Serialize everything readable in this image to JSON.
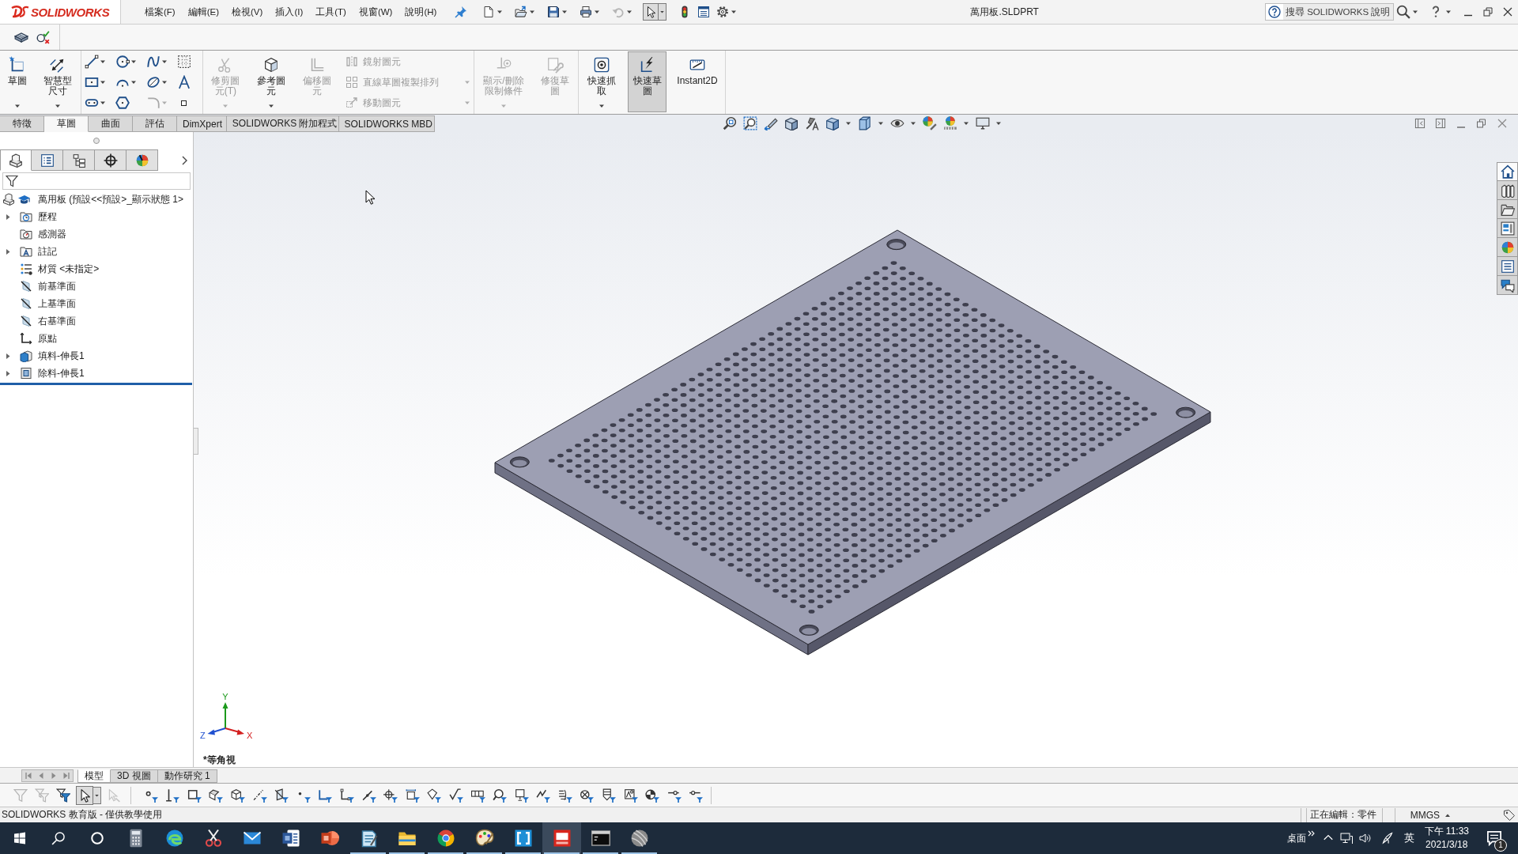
{
  "titlebar": {
    "logo": "SOLIDWORKS",
    "menus": [
      "檔案(F)",
      "編輯(E)",
      "檢視(V)",
      "插入(I)",
      "工具(T)",
      "視窗(W)",
      "說明(H)"
    ],
    "quick_access": [
      {
        "kind": "new",
        "dropdown": true,
        "disabled": false,
        "pressed": false
      },
      {
        "kind": "open",
        "dropdown": true,
        "disabled": false,
        "pressed": false
      },
      {
        "kind": "save",
        "dropdown": true,
        "disabled": false,
        "pressed": false
      },
      {
        "kind": "print",
        "dropdown": true,
        "disabled": false,
        "pressed": false
      },
      {
        "kind": "undo",
        "dropdown": true,
        "disabled": true,
        "pressed": false
      },
      {
        "kind": "select",
        "dropdown": true,
        "disabled": false,
        "pressed": true
      },
      {
        "kind": "rebuild",
        "dropdown": false,
        "disabled": false,
        "pressed": false
      },
      {
        "kind": "file-properties",
        "dropdown": false,
        "disabled": false,
        "pressed": false
      },
      {
        "kind": "options",
        "dropdown": true,
        "disabled": false,
        "pressed": false
      }
    ],
    "title": "萬用板.SLDPRT",
    "search": {
      "placeholder": "搜尋 SOLIDWORKS 說明"
    }
  },
  "ribbon": [
    {
      "items": [
        {
          "kind": "sketch",
          "label": "草圖",
          "dropdown": true,
          "disabled": false,
          "pressed": false
        },
        {
          "kind": "smart-dimension",
          "label": "智慧型尺寸",
          "dropdown": true,
          "disabled": false,
          "pressed": false
        }
      ]
    },
    {
      "items": [
        {
          "tools": [
            {
              "kind": "line",
              "dropdown": true,
              "disabled": false
            },
            {
              "kind": "circle",
              "dropdown": true,
              "disabled": false
            },
            {
              "kind": "spline",
              "dropdown": true,
              "disabled": false
            },
            {
              "kind": "grid-snap",
              "dropdown": false,
              "disabled": false
            },
            {
              "kind": "rectangle",
              "dropdown": true,
              "disabled": false
            },
            {
              "kind": "arc",
              "dropdown": true,
              "disabled": false
            },
            {
              "kind": "ellipse",
              "dropdown": true,
              "disabled": false
            },
            {
              "kind": "text",
              "dropdown": false,
              "disabled": false
            },
            {
              "kind": "slot",
              "dropdown": true,
              "disabled": false
            },
            {
              "kind": "polygon",
              "dropdown": false,
              "disabled": false
            },
            {
              "kind": "fillet",
              "dropdown": true,
              "disabled": true
            },
            {
              "kind": "point",
              "dropdown": false,
              "disabled": false
            }
          ]
        }
      ]
    },
    {
      "items": [
        {
          "kind": "trim-entities",
          "label": "修剪圖元(T)",
          "dropdown": true,
          "disabled": true,
          "pressed": false
        },
        {
          "kind": "convert-entities",
          "label": "參考圖元",
          "dropdown": true,
          "disabled": false,
          "pressed": false
        },
        {
          "kind": "offset-entities",
          "label": "偏移圖元",
          "dropdown": false,
          "disabled": true,
          "pressed": false
        },
        {
          "rows": [
            {
              "kind": "mirror-entities",
              "label": "鏡射圖元",
              "dropdown": false,
              "disabled": true
            },
            {
              "kind": "linear-pattern",
              "label": "直線草圖複製排列",
              "dropdown": true,
              "disabled": true
            },
            {
              "kind": "move-entities",
              "label": "移動圖元",
              "dropdown": true,
              "disabled": true
            }
          ]
        }
      ]
    },
    {
      "items": [
        {
          "kind": "display-relations",
          "label": "顯示/刪除限制條件",
          "dropdown": true,
          "disabled": true,
          "pressed": false
        },
        {
          "kind": "repair-sketch",
          "label": "修復草圖",
          "dropdown": false,
          "disabled": true,
          "pressed": false
        }
      ]
    },
    {
      "items": [
        {
          "kind": "quick-snaps",
          "label": "快速抓取",
          "dropdown": true,
          "disabled": false,
          "pressed": false
        },
        {
          "kind": "rapid-sketch",
          "label": "快速草圖",
          "dropdown": false,
          "disabled": false,
          "pressed": true
        },
        {
          "kind": "instant2d",
          "label": "Instant2D",
          "dropdown": false,
          "disabled": false,
          "pressed": false
        }
      ]
    }
  ],
  "command_tabs": [
    {
      "label": "特徵",
      "selected": false
    },
    {
      "label": "草圖",
      "selected": true
    },
    {
      "label": "曲面",
      "selected": false
    },
    {
      "label": "評估",
      "selected": false
    },
    {
      "label": "DimXpert",
      "selected": false
    },
    {
      "label": "SOLIDWORKS 附加程式",
      "selected": false
    },
    {
      "label": "SOLIDWORKS MBD",
      "selected": false
    }
  ],
  "view_toolbar": [
    {
      "kind": "zoom-fit",
      "dropdown": false
    },
    {
      "kind": "zoom-area",
      "dropdown": false
    },
    {
      "kind": "previous-view",
      "dropdown": false
    },
    {
      "kind": "section-view",
      "dropdown": false
    },
    {
      "kind": "annotation-views",
      "dropdown": false
    },
    {
      "kind": "view-orientation",
      "dropdown": true
    },
    {
      "kind": "display-style",
      "dropdown": true
    },
    {
      "kind": "hide-show",
      "dropdown": true
    },
    {
      "kind": "edit-appearance",
      "dropdown": false
    },
    {
      "kind": "apply-scene",
      "dropdown": true
    },
    {
      "kind": "view-settings",
      "dropdown": true
    }
  ],
  "feature_manager": {
    "tabs": [
      {
        "kind": "features",
        "selected": true
      },
      {
        "kind": "properties",
        "selected": false
      },
      {
        "kind": "configurations",
        "selected": false
      },
      {
        "kind": "dimxpert",
        "selected": false
      },
      {
        "kind": "display-manager",
        "selected": false
      }
    ],
    "tree": {
      "kind": "part",
      "label": "萬用板 (預設<<預設>_顯示狀態 1>",
      "children": [
        {
          "kind": "history",
          "label": "歷程",
          "expandable": true
        },
        {
          "kind": "sensors",
          "label": "感測器",
          "expandable": false
        },
        {
          "kind": "annotations",
          "label": "註記",
          "expandable": true
        },
        {
          "kind": "material",
          "label": "材質 <未指定>",
          "expandable": false
        },
        {
          "kind": "plane",
          "label": "前基準面",
          "expandable": false
        },
        {
          "kind": "plane",
          "label": "上基準面",
          "expandable": false
        },
        {
          "kind": "plane",
          "label": "右基準面",
          "expandable": false
        },
        {
          "kind": "origin",
          "label": "原點",
          "expandable": false
        },
        {
          "kind": "boss-extrude",
          "label": "填料-伸長1",
          "expandable": true
        },
        {
          "kind": "cut-extrude",
          "label": "除料-伸長1",
          "expandable": true
        }
      ]
    }
  },
  "graphics": {
    "view_name": "*等角視",
    "triad": {
      "x": "X",
      "y": "Y",
      "z": "Z"
    }
  },
  "task_pane": [
    {
      "kind": "resources",
      "selected": true
    },
    {
      "kind": "design-library",
      "selected": false
    },
    {
      "kind": "file-explorer",
      "selected": false
    },
    {
      "kind": "view-palette",
      "selected": false
    },
    {
      "kind": "appearances",
      "selected": false
    },
    {
      "kind": "custom-properties",
      "selected": false
    },
    {
      "kind": "forum",
      "selected": false
    }
  ],
  "model_tabs": [
    {
      "label": "模型",
      "selected": true
    },
    {
      "label": "3D 視圖",
      "selected": false
    },
    {
      "label": "動作研究 1",
      "selected": false
    }
  ],
  "selection_tools": [
    {
      "kind": "filter-toggle",
      "dropdown": false,
      "disabled": true,
      "pressed": false
    },
    {
      "kind": "filter-stack",
      "dropdown": false,
      "disabled": true,
      "pressed": false
    },
    {
      "kind": "filter-all",
      "dropdown": false,
      "disabled": false,
      "pressed": false
    },
    {
      "kind": "select",
      "dropdown": true,
      "disabled": false,
      "pressed": true
    },
    {
      "kind": "select-other",
      "dropdown": false,
      "disabled": true,
      "pressed": false
    }
  ],
  "filters": [
    {
      "kind": "vertex"
    },
    {
      "kind": "edge"
    },
    {
      "kind": "face"
    },
    {
      "kind": "surface-body"
    },
    {
      "kind": "solid-body"
    },
    {
      "kind": "axis"
    },
    {
      "kind": "ref-plane"
    },
    {
      "kind": "sketch-point"
    },
    {
      "kind": "sketch-segment"
    },
    {
      "kind": "midpoint"
    },
    {
      "kind": "center-mark"
    },
    {
      "kind": "centerline"
    },
    {
      "kind": "dimension"
    },
    {
      "kind": "datum-feature"
    },
    {
      "kind": "surface-finish"
    },
    {
      "kind": "gtol"
    },
    {
      "kind": "balloon"
    },
    {
      "kind": "datum"
    },
    {
      "kind": "weld"
    },
    {
      "kind": "hatch"
    },
    {
      "kind": "datum-target"
    },
    {
      "kind": "cosmetic-thread"
    },
    {
      "kind": "block"
    },
    {
      "kind": "mass-center"
    },
    {
      "kind": "connection-point"
    },
    {
      "kind": "routing-point"
    }
  ],
  "status_bar": {
    "message": "SOLIDWORKS 教育版 - 僅供教學使用",
    "editing": "正在編輯：零件",
    "units": "MMGS"
  },
  "taskbar": {
    "apps": [
      {
        "kind": "calculator",
        "running": false,
        "active": false
      },
      {
        "kind": "browser-swirl",
        "running": false,
        "active": false
      },
      {
        "kind": "snipping",
        "running": false,
        "active": false
      },
      {
        "kind": "mail",
        "running": false,
        "active": false
      },
      {
        "kind": "word-processor",
        "running": false,
        "active": false
      },
      {
        "kind": "presentation",
        "running": false,
        "active": false
      },
      {
        "kind": "notepad",
        "running": true,
        "active": false
      },
      {
        "kind": "files",
        "running": true,
        "active": false
      },
      {
        "kind": "web-browser",
        "running": true,
        "active": false
      },
      {
        "kind": "paint",
        "running": true,
        "active": false
      },
      {
        "kind": "tile-app",
        "running": true,
        "active": false
      },
      {
        "kind": "cad",
        "running": true,
        "active": true
      },
      {
        "kind": "terminal",
        "running": true,
        "active": false
      },
      {
        "kind": "sphere",
        "running": true,
        "active": false
      }
    ],
    "tray": {
      "desktop": "桌面",
      "input_method": "英",
      "time": "下午 11:33",
      "date": "2021/3/18",
      "notifications": "1"
    }
  }
}
